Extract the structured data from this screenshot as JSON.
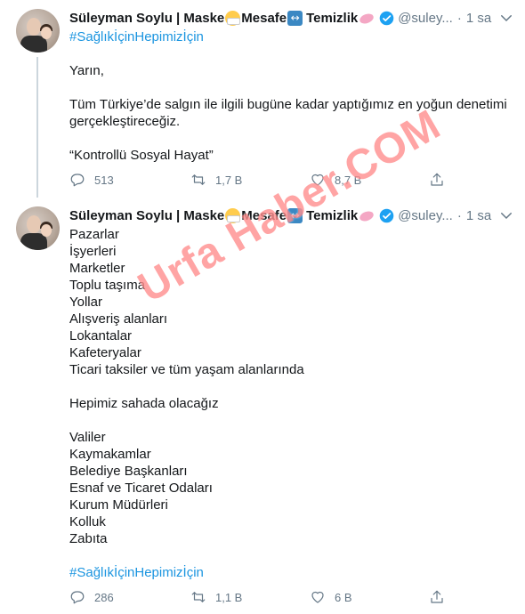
{
  "tweets": [
    {
      "author_name": "Süleyman Soylu | Maske",
      "name_part2": "Mesafe",
      "name_part3": "Temizlik",
      "handle": "@suley...",
      "time": "1 sa",
      "hashtag_top": "#SağlıkİçinHepimizİçin",
      "lines": [
        "Yarın,",
        "",
        "Tüm Türkiye’de salgın ile ilgili bugüne kadar yaptığımız en yoğun denetimi gerçekleştireceğiz.",
        "",
        "“Kontrollü Sosyal Hayat”"
      ],
      "replies": "513",
      "retweets": "1,7 B",
      "likes": "8,7 B"
    },
    {
      "author_name": "Süleyman Soylu | Maske",
      "name_part2": "Mesafe",
      "name_part3": "Temizlik",
      "handle": "@suley...",
      "time": "1 sa",
      "lines": [
        "Pazarlar",
        "İşyerleri",
        "Marketler",
        "Toplu taşıma",
        "Yollar",
        "Alışveriş alanları",
        "Lokantalar",
        "Kafeteryalar",
        "Ticari taksiler ve tüm yaşam alanlarında",
        "",
        "Hepimiz sahada olacağız",
        "",
        "Valiler",
        "Kaymakamlar",
        "Belediye Başkanları",
        "Esnaf ve Ticaret Odaları",
        "Kurum Müdürleri",
        "Kolluk",
        "Zabıta",
        ""
      ],
      "hashtag_bottom": "#SağlıkİçinHepimizİçin",
      "replies": "286",
      "retweets": "1,1 B",
      "likes": "6 B"
    }
  ],
  "watermark": "Urfa Haber.COM",
  "colors": {
    "accent": "#1b95e0",
    "muted": "#657786",
    "thread": "#ccd6dd"
  },
  "icons": [
    "reply-icon",
    "retweet-icon",
    "like-icon",
    "share-icon",
    "verified-badge-icon",
    "chevron-down-icon"
  ]
}
